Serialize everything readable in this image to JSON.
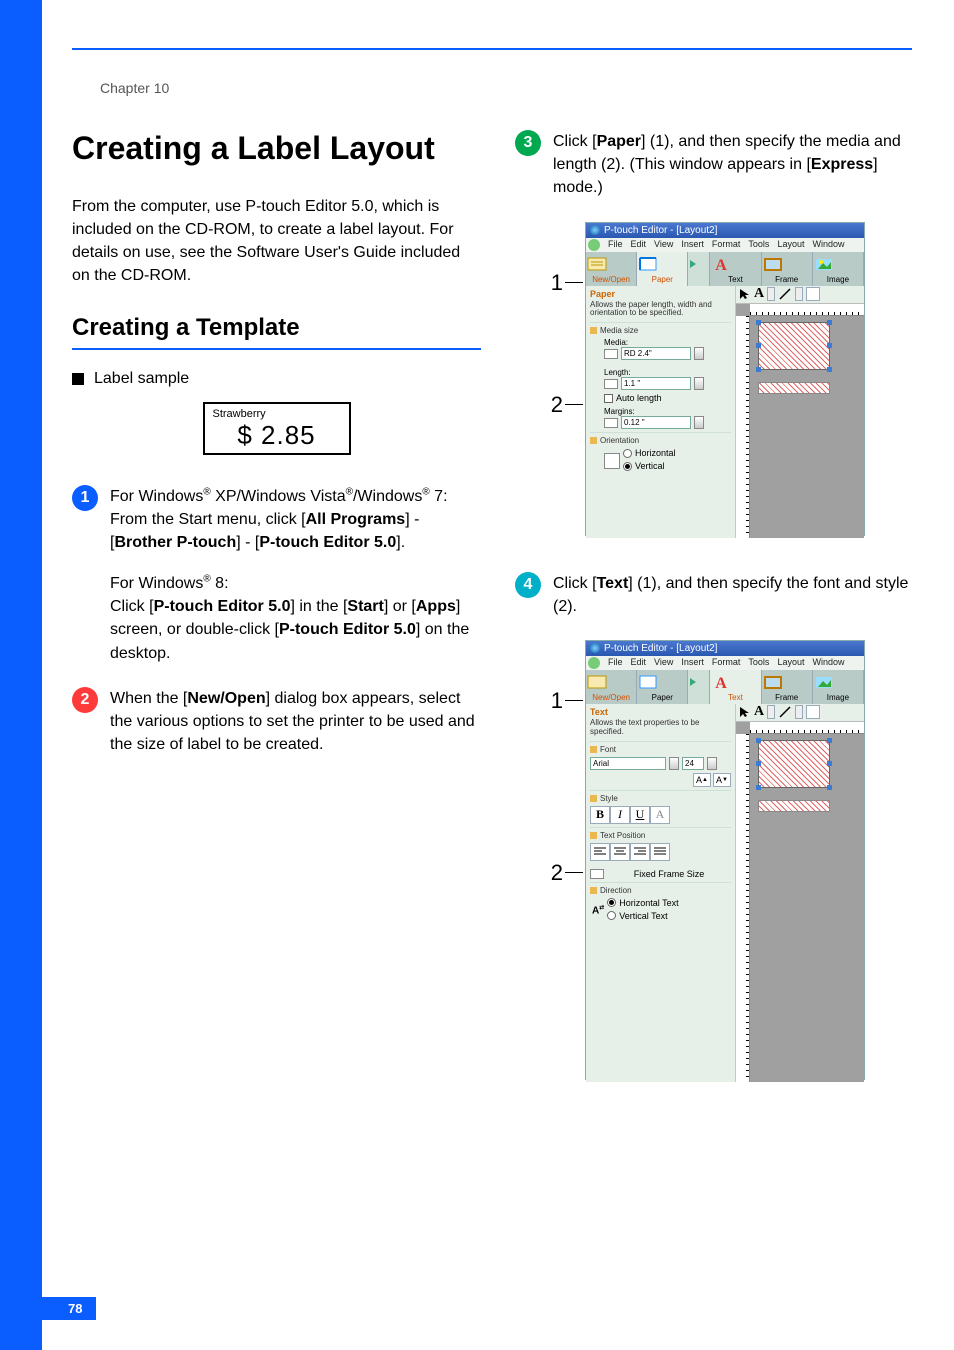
{
  "chapter": "Chapter 10",
  "page_number": "78",
  "h1": "Creating a Label Layout",
  "intro": "From the computer, use P-touch Editor 5.0, which is included on the CD-ROM, to create a label layout. For details on use, see the Software User's Guide included on the CD-ROM.",
  "h2": "Creating a Template",
  "label_sample_label": "Label sample",
  "label_sample": {
    "name": "Strawberry",
    "price": "$  2.85"
  },
  "steps": {
    "s1": {
      "para1_pre": "For Windows",
      "para1_mid": " XP/Windows Vista",
      "para1_mid2": "/Windows",
      "para1_end": " 7:",
      "line2": "From the Start menu, click [",
      "all_programs": "All Programs",
      "line2b": "] - [",
      "brother": "Brother P-touch",
      "line2c": "] - [",
      "pte": "P-touch Editor 5.0",
      "line2d": "].",
      "w8_pre": "For Windows",
      "w8_end": " 8:",
      "w8_a": "Click [",
      "w8_pte": "P-touch Editor 5.0",
      "w8_b": "] in the [",
      "w8_start": "Start",
      "w8_c": "] or [",
      "w8_apps": "Apps",
      "w8_d": "] screen, or double-click [",
      "w8_pte2": "P-touch Editor 5.0",
      "w8_e": "] on the desktop."
    },
    "s2": {
      "a": "When the [",
      "newopen": "New/Open",
      "b": "] dialog box appears, select the various options to set the printer to be used and the size of label to be created."
    },
    "s3": {
      "a": "Click [",
      "paper": "Paper",
      "b": "] (1), and then specify the media and length (2). (This window appears in [",
      "express": "Express",
      "c": "] mode.)"
    },
    "s4": {
      "a": "Click [",
      "text": "Text",
      "b": "] (1), and then specify the font and style (2)."
    }
  },
  "callout": {
    "one": "1",
    "two": "2"
  },
  "screenshot_common": {
    "title": "P-touch Editor - [Layout2]",
    "menu": [
      "File",
      "Edit",
      "View",
      "Insert",
      "Format",
      "Tools",
      "Layout",
      "Window"
    ],
    "tabs": {
      "newopen": "New/Open",
      "paper": "Paper",
      "text": "Text",
      "frame": "Frame",
      "image": "Image"
    }
  },
  "ss1": {
    "panel_head": "Paper",
    "panel_desc": "Allows the paper length, width and orientation to be specified.",
    "grp_media": "Media size",
    "media_label": "Media:",
    "media_value": "RD 2.4\"",
    "length_label": "Length:",
    "length_value": "1.1 \"",
    "auto_length": "Auto length",
    "margins_label": "Margins:",
    "margins_value": "0.12 \"",
    "grp_orient": "Orientation",
    "orient_h": "Horizontal",
    "orient_v": "Vertical"
  },
  "ss2": {
    "panel_head": "Text",
    "panel_desc": "Allows the text properties to be specified.",
    "grp_font": "Font",
    "font_name": "Arial",
    "font_size": "24",
    "grp_style": "Style",
    "grp_pos": "Text Position",
    "ffs": "Fixed Frame Size",
    "grp_dir": "Direction",
    "dir_h": "Horizontal Text",
    "dir_v": "Vertical Text"
  }
}
